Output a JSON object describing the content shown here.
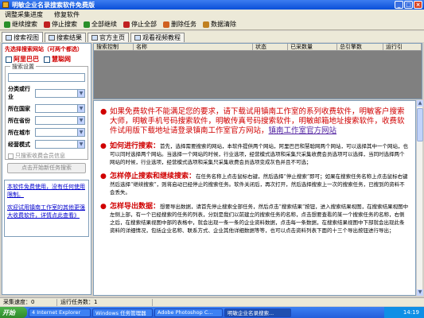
{
  "window": {
    "title": "明敏企业名录搜索软件免费版"
  },
  "menu": [
    "调整采集进度",
    "修复软件"
  ],
  "toolbar": [
    {
      "label": "继续搜索",
      "icon": "play-icon",
      "color": "#2a8f2a"
    },
    {
      "label": "停止搜索",
      "icon": "stop-icon",
      "color": "#c02020"
    },
    {
      "label": "全部继续",
      "icon": "play-all-icon",
      "color": "#2a8f2a"
    },
    {
      "label": "停止全部",
      "icon": "stop-all-icon",
      "color": "#c02020"
    },
    {
      "label": "删除任务",
      "icon": "delete-icon",
      "color": "#d06020"
    },
    {
      "label": "数据清除",
      "icon": "clear-icon",
      "color": "#c08020"
    }
  ],
  "tabs": [
    "搜索视图",
    "搜索结果",
    "官方主页",
    "观看视频教程"
  ],
  "sidebar": {
    "header": "先选择搜索网站（可两个都选）",
    "sites": [
      "阿里巴巴",
      "慧聪网"
    ],
    "group_label": "搜索设置",
    "keyword_value": "",
    "fields": [
      "分类或行业",
      "所在国家",
      "所在省份",
      "所在城市",
      "经营模式"
    ],
    "only_contact": "只搜索收费会员信息",
    "start_button": "点击开始新任务搜索",
    "links": [
      "本软件免费使用，没有任何使用限制。",
      "欢迎试用镇南工作室的其他更强大收费软件，详情点此查看》"
    ]
  },
  "grid": {
    "columns": [
      "搜索控制",
      "名称",
      "状态",
      "已采数量",
      "总引擎数",
      "运行引"
    ]
  },
  "content": {
    "intro": "如果免费软件不能满足您的要求，请下载试用镇南工作室的系列收费软件，明敏客户搜索大师，明敏手机号码搜索软件，明敏传真号码搜索软件，明敏邮箱地址搜索软件，收费软件试用版下载地址请登录镇南工作室官方网站，",
    "intro_link": "镇南工作室官方网站",
    "sections": [
      {
        "title": "如何进行搜索：",
        "body": "首先，选择需要搜索的网站，本软件提供两个网站，阿里巴巴和慧聪网两个网站，可以选择其中一个网站，也可以同时选择两个网站。当选择一个网站的时候，行业选项，经营模式选项和采集只采集收费会员选项可以选择，当同时选择两个网站的时候，行业选项，经营模式选项和采集只采集收费会员选项变成灰色并且不可选；"
      },
      {
        "title": "怎样停止搜索和继续搜索：",
        "body": "在任务名称上点击鼠标右键，然后选择“停止搜索”即可；如果在搜索任务名称上点击鼠标右键然后选择“继续搜索”，则将启动已经停止的搜索任务。软件关闭后，再次打开，然后选择搜索上一次的搜索任务，已搜到的资料不会丢失。"
      },
      {
        "title": "怎样导出数据：",
        "body": "想要导出数据，请首先停止搜索全部任务，然后点击“搜索结果”按钮，进入搜索结果视图，在搜索结果视图中左侧上部，有一个已经搜索的任务的列表，分别是我们以前建立的搜索任务的名称，点击想要查看的某一个搜索任务的名称，右侧之后，在搜索结果视图中部的表格中，就会出现一条一条的企业资料数据，点击每一条数据，在搜索结果视图中下部就会出现此条资料的详细情况，包括企业名称、联系方式、企业其他详细数据等等，也可以点击资料列表下面的十三个导出按钮进行导出；"
      }
    ]
  },
  "status": {
    "collected": "采集速度：0",
    "tasks": "运行任务数：1"
  },
  "taskbar": {
    "start": "开始",
    "tasks": [
      "4 Internet Explorer",
      "Windows 任务管理器",
      "Adobe Photoshop C...",
      "明敏企业名录搜索..."
    ],
    "clock": "14:19"
  }
}
